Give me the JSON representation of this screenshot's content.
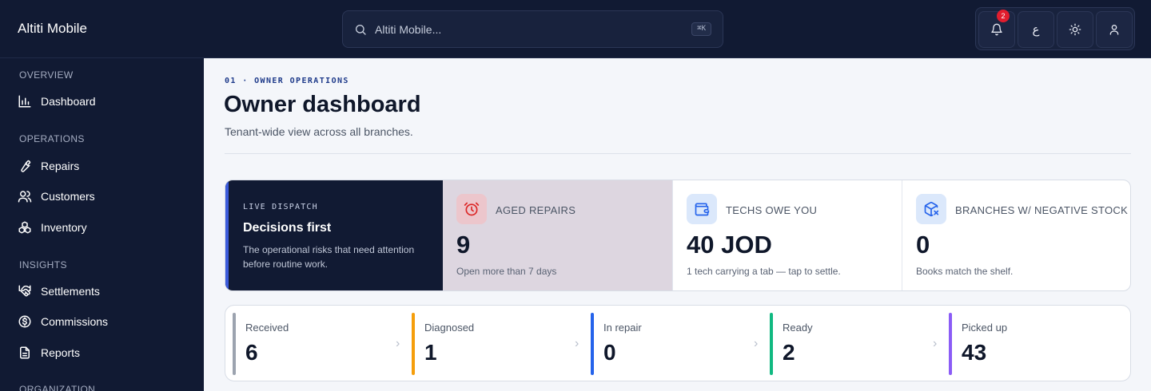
{
  "app": {
    "name": "Altiti Mobile"
  },
  "search": {
    "value": "Altiti Mobile...",
    "shortcut": "⌘K"
  },
  "top_actions": {
    "notifications_count": "2",
    "language_label": "ع"
  },
  "sidebar": {
    "sections": [
      {
        "title": "OVERVIEW",
        "items": [
          {
            "label": "Dashboard",
            "icon": "bar-chart-icon"
          }
        ]
      },
      {
        "title": "OPERATIONS",
        "items": [
          {
            "label": "Repairs",
            "icon": "wrench-icon"
          },
          {
            "label": "Customers",
            "icon": "users-icon"
          },
          {
            "label": "Inventory",
            "icon": "boxes-icon"
          }
        ]
      },
      {
        "title": "INSIGHTS",
        "items": [
          {
            "label": "Settlements",
            "icon": "handshake-icon"
          },
          {
            "label": "Commissions",
            "icon": "dollar-circle-icon"
          },
          {
            "label": "Reports",
            "icon": "document-icon"
          }
        ]
      },
      {
        "title": "ORGANIZATION",
        "items": []
      }
    ]
  },
  "header": {
    "eyebrow": "01 · OWNER OPERATIONS",
    "title": "Owner dashboard",
    "subtitle": "Tenant-wide view across all branches."
  },
  "dispatch": {
    "label": "LIVE DISPATCH",
    "title": "Decisions first",
    "description": "The operational risks that need attention before routine work."
  },
  "kpis": [
    {
      "label": "AGED REPAIRS",
      "value": "9",
      "note": "Open more than 7 days",
      "icon": "clock-icon",
      "color": "#dc2626"
    },
    {
      "label": "TECHS OWE YOU",
      "value": "40 JOD",
      "note": "1 tech carrying a tab — tap to settle.",
      "icon": "wallet-icon",
      "color": "#2563eb"
    },
    {
      "label": "BRANCHES W/ NEGATIVE STOCK",
      "value": "0",
      "note": "Books match the shelf.",
      "icon": "box-x-icon",
      "color": "#2563eb"
    }
  ],
  "pipeline": [
    {
      "label": "Received",
      "value": "6",
      "color": "#9ca3af"
    },
    {
      "label": "Diagnosed",
      "value": "1",
      "color": "#f59e0b"
    },
    {
      "label": "In repair",
      "value": "0",
      "color": "#2563eb"
    },
    {
      "label": "Ready",
      "value": "2",
      "color": "#10b981"
    },
    {
      "label": "Picked up",
      "value": "43",
      "color": "#8b5cf6"
    }
  ]
}
